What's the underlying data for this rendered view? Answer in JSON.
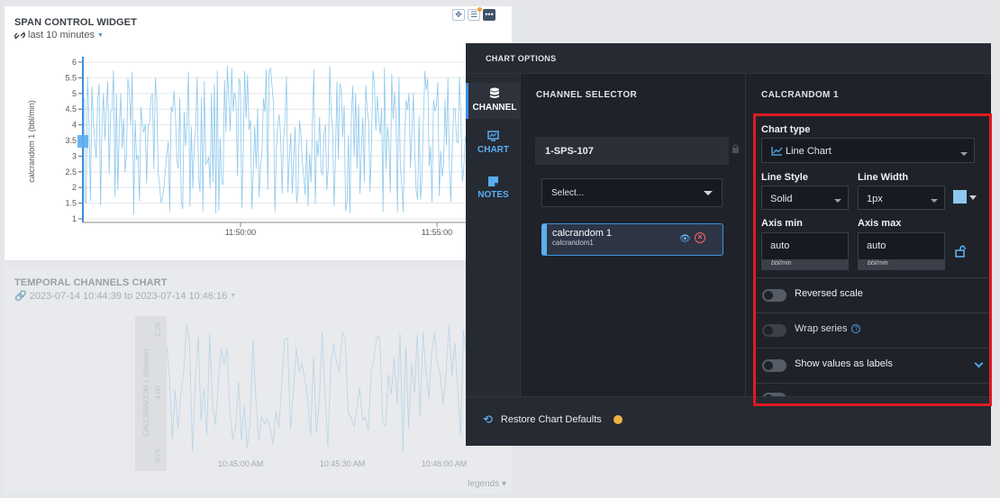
{
  "widget1": {
    "title": "SPAN CONTROL WIDGET",
    "subtitle": "last 10 minutes",
    "y_label": "calcrandom 1 (bbl/min)",
    "y_ticks": [
      "6",
      "5.5",
      "5",
      "4.5",
      "4",
      "3.5",
      "3",
      "2.5",
      "2",
      "1.5",
      "1"
    ],
    "x_ticks": [
      "11:50:00",
      "11:55:00"
    ]
  },
  "widget2": {
    "title": "TEMPORAL CHANNELS CHART",
    "subtitle": "2023-07-14 10:44:39 to 2023-07-14 10:46:16",
    "y_label": "CALCRANDOM 1 (bbl/min)",
    "y_ticks": [
      "6.25",
      "4.00",
      "0.75"
    ],
    "x_ticks": [
      "10:45:00 AM",
      "10:45:30 AM",
      "10:46:00 AM"
    ],
    "legends_label": "legends"
  },
  "panel": {
    "title": "CHART OPTIONS",
    "rail": [
      {
        "label": "CHANNEL",
        "icon": "database-icon",
        "active": true
      },
      {
        "label": "CHART",
        "icon": "chart-icon",
        "active": false
      },
      {
        "label": "NOTES",
        "icon": "notes-icon",
        "active": false
      }
    ],
    "channel_selector": {
      "heading": "CHANNEL SELECTOR",
      "device": "1-SPS-107",
      "select_placeholder": "Select...",
      "channel": {
        "name": "calcrandom 1",
        "id": "calcrandom1"
      }
    },
    "settings": {
      "heading": "CALCRANDOM 1",
      "chart_type_label": "Chart type",
      "chart_type_value": "Line Chart",
      "line_style_label": "Line Style",
      "line_style_value": "Solid",
      "line_width_label": "Line Width",
      "line_width_value": "1px",
      "line_color": "#8ec8ec",
      "axis_min_label": "Axis min",
      "axis_min_value": "auto",
      "axis_max_label": "Axis max",
      "axis_max_value": "auto",
      "unit": "bbl/min",
      "toggles": [
        {
          "label": "Reversed scale",
          "on": false
        },
        {
          "label": "Wrap series",
          "on": false,
          "help": true
        },
        {
          "label": "Show values as labels",
          "on": false,
          "expand": true
        }
      ]
    },
    "footer": {
      "restore_label": "Restore Chart Defaults"
    }
  },
  "colors": {
    "accent": "#3d8ee0",
    "series": "#8ec8ec",
    "highlight": "#e01a22"
  }
}
